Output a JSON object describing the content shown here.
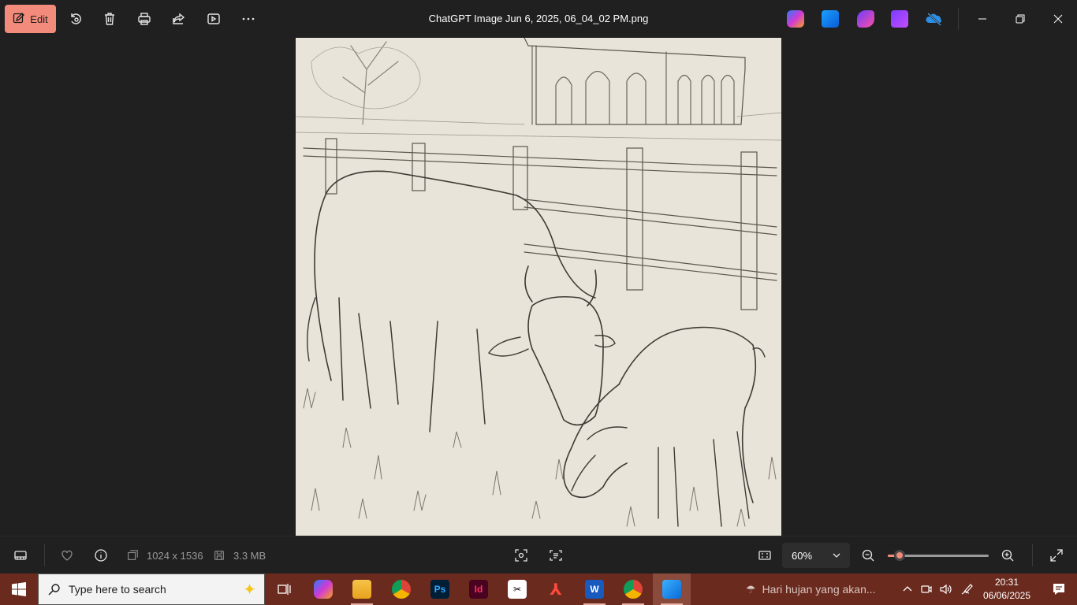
{
  "toolbar": {
    "edit_label": "Edit",
    "file_title": "ChatGPT Image Jun 6, 2025, 06_04_02 PM.png",
    "icons": [
      "edit-icon",
      "rotate-icon",
      "delete-icon",
      "print-icon",
      "share-icon",
      "slideshow-icon",
      "more-icon"
    ],
    "app_icons": [
      "copilot-icon",
      "photos-editor-icon",
      "designer-icon",
      "clipchamp-icon",
      "onedrive-icon"
    ]
  },
  "status": {
    "dimensions": "1024 x 1536",
    "file_size": "3.3 MB",
    "zoom_value": "60%",
    "zoom_fraction": 0.12
  },
  "taskbar": {
    "search_placeholder": "Type here to search",
    "apps": [
      "task-view",
      "copilot",
      "file-explorer",
      "chrome",
      "photoshop",
      "indesign",
      "capcut",
      "acrobat",
      "word",
      "chrome-profile",
      "photos"
    ],
    "weather_text": "Hari hujan yang akan...",
    "time": "20:31",
    "date": "06/06/2025"
  },
  "colors": {
    "accent": "#f28b7b",
    "background": "#202020",
    "taskbar": "#6b2a1e",
    "canvas_paper": "#e9e4d9"
  }
}
